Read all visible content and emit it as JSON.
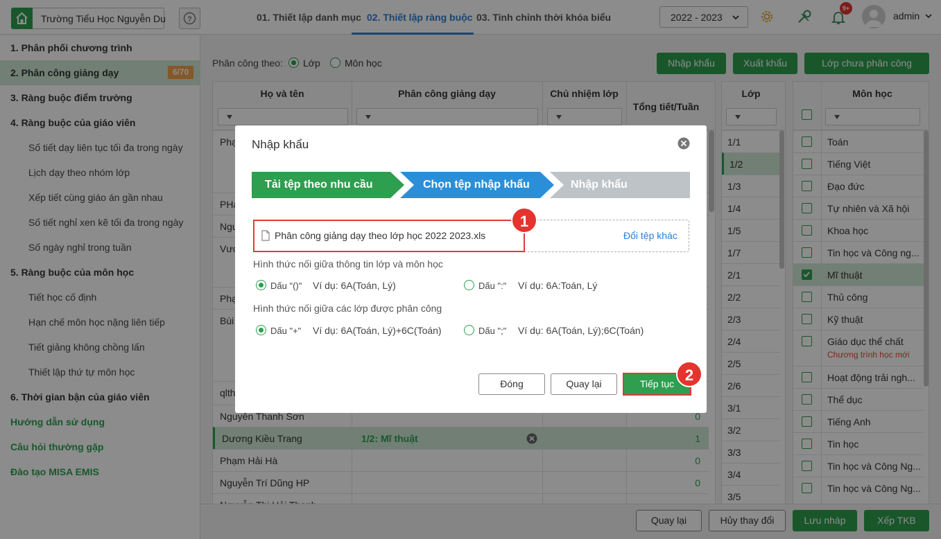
{
  "header": {
    "school_name": "Trường Tiểu Học Nguyễn Du",
    "steps": [
      "01. Thiết lập danh mục",
      "02. Thiết lập ràng buộc",
      "03. Tinh chỉnh thời khóa biểu"
    ],
    "year": "2022 - 2023",
    "notif_badge": "9+",
    "user": "admin"
  },
  "sidebar": {
    "items": [
      "1. Phân phối chương trình",
      "2. Phân công giảng dạy",
      "3. Ràng buộc điểm trường",
      "4. Ràng buộc của giáo viên",
      "Số tiết dạy liên tục tối đa trong ngày",
      "Lịch dạy theo nhóm lớp",
      "Xếp tiết cùng giáo án gần nhau",
      "Số tiết nghỉ xen kẽ tối đa trong ngày",
      "Số ngày nghỉ trong tuần",
      "5. Ràng buộc của môn học",
      "Tiết học cố định",
      "Hạn chế môn học nặng liên tiếp",
      "Tiết giảng không chồng lấn",
      "Thiết lập thứ tự môn học",
      "6. Thời gian bận của giáo viên",
      "Hướng dẫn sử dụng",
      "Câu hỏi thường gặp",
      "Đào tạo MISA EMIS"
    ],
    "count": "6/70"
  },
  "toolbar": {
    "assign_by_label": "Phân công theo:",
    "opt_class": "Lớp",
    "opt_subject": "Môn học",
    "import": "Nhập khẩu",
    "export": "Xuất khẩu",
    "unassigned": "Lớp chưa phân công"
  },
  "table": {
    "headers": [
      "Họ và tên",
      "Phân công giảng dạy",
      "Chủ nhiệm lớp",
      "Tổng tiết/Tuần"
    ],
    "rows": [
      {
        "name": "Phạ",
        "assign": "",
        "total": ""
      },
      {
        "name": "PHạ",
        "assign": "",
        "total": ""
      },
      {
        "name": "Ngu",
        "assign": "",
        "total": ""
      },
      {
        "name": "Vươ",
        "assign": "",
        "total": ""
      },
      {
        "name": "Phạ",
        "assign": "",
        "total": ""
      },
      {
        "name": "Bùi",
        "assign": "",
        "total": ""
      },
      {
        "name": "qlth",
        "assign": "",
        "total": ""
      },
      {
        "name": "Nguyễn Thanh Sơn",
        "assign": "",
        "total": "0"
      },
      {
        "name": "Dương Kiều Trang",
        "assign": "1/2: Mĩ thuật",
        "total": "1"
      },
      {
        "name": "Phạm Hải Hà",
        "assign": "",
        "total": "0"
      },
      {
        "name": "Nguyễn Trí Dũng HP",
        "assign": "",
        "total": "0"
      },
      {
        "name": "Nguyễn Thị Hải Thanh",
        "assign": "",
        "total": ""
      }
    ]
  },
  "classes": {
    "header": "Lớp",
    "items": [
      "1/1",
      "1/2",
      "1/3",
      "1/4",
      "1/5",
      "1/7",
      "2/1",
      "2/2",
      "2/3",
      "2/4",
      "2/5",
      "2/6",
      "3/1",
      "3/2",
      "3/3",
      "3/4",
      "3/5"
    ]
  },
  "subjects": {
    "header": "Môn học",
    "items": [
      "Toán",
      "Tiếng Việt",
      "Đạo đức",
      "Tự nhiên và Xã hội",
      "Khoa học",
      "Tin học và Công ng...",
      "Mĩ thuật",
      "Thủ công",
      "Kỹ thuật",
      "Giáo dục thể chất",
      "Hoạt động trải ngh...",
      "Thể dục",
      "Tiếng Anh",
      "Tin học",
      "Tin học và Công Ng...",
      "Tin học và Công Ng..."
    ],
    "sub_note": "Chương trình học mới"
  },
  "footer": {
    "back": "Quay lại",
    "discard": "Hủy thay đổi",
    "save_draft": "Lưu nháp",
    "schedule": "Xếp TKB"
  },
  "modal": {
    "title": "Nhập khẩu",
    "steps": [
      "Tải tệp theo nhu cầu",
      "Chọn tệp nhập khẩu",
      "Nhập khẩu"
    ],
    "file_name": "Phân công giảng dạy theo lớp học 2022 2023.xls",
    "change_file": "Đổi tệp khác",
    "section1": "Hình thức nối giữa thông tin lớp và môn học",
    "s1_opt1": "Dấu \"()\"",
    "s1_ex1": "Ví dụ: 6A(Toán, Lý)",
    "s1_opt2": "Dấu \":\"",
    "s1_ex2": "Ví dụ: 6A:Toán, Lý",
    "section2": "Hình thức nối giữa các lớp được phân công",
    "s2_opt1": "Dấu \"+\"",
    "s2_ex1": "Ví dụ: 6A(Toán, Lý)+6C(Toán)",
    "s2_opt2": "Dấu \";\"",
    "s2_ex2": "Ví dụ: 6A(Toán, Lý);6C(Toán)",
    "close": "Đóng",
    "back": "Quay lại",
    "continue": "Tiếp tục",
    "callout1": "1",
    "callout2": "2"
  }
}
